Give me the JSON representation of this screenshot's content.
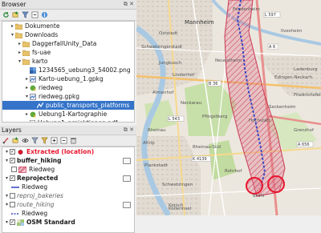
{
  "browser": {
    "title": "Browser",
    "controls": "⧉ ✕",
    "items": [
      {
        "label": "Dokumente",
        "depth": 1,
        "icon": "folder-icon",
        "expanded": false
      },
      {
        "label": "Downloads",
        "depth": 1,
        "icon": "folder-icon",
        "expanded": true
      },
      {
        "label": "DaggerfallUnity_Data",
        "depth": 2,
        "icon": "folder-icon",
        "expanded": false
      },
      {
        "label": "fs-uae",
        "depth": 2,
        "icon": "folder-icon",
        "expanded": false
      },
      {
        "label": "karto",
        "depth": 2,
        "icon": "folder-icon",
        "expanded": true
      },
      {
        "label": "1234565_uebung3_54002.png",
        "depth": 3,
        "icon": "raster-icon",
        "expanded": null
      },
      {
        "label": "Karto-uebung_1.gpkg",
        "depth": 3,
        "icon": "geopackage-icon",
        "expanded": false
      },
      {
        "label": "riedweg",
        "depth": 3,
        "icon": "qgis-project-icon",
        "expanded": false
      },
      {
        "label": "riedweg.gpkg",
        "depth": 3,
        "icon": "geopackage-icon",
        "expanded": true
      },
      {
        "label": "public_transports_platforms",
        "depth": 4,
        "icon": "line-layer-icon",
        "expanded": null,
        "selected": true
      },
      {
        "label": "Uebung1-Kartographie",
        "depth": 3,
        "icon": "qgis-project-icon",
        "expanded": false
      },
      {
        "label": "Uebung1_projektionen.pdf",
        "depth": 3,
        "icon": "pdf-icon",
        "expanded": null
      }
    ]
  },
  "layers": {
    "title": "Layers",
    "controls": "⧉ ✕",
    "items": [
      {
        "label": "Extracted (location)",
        "depth": 0,
        "checked": true,
        "style": "bold-selected",
        "sym": "point",
        "indicator": false
      },
      {
        "label": "buffer_hiking",
        "depth": 0,
        "checked": true,
        "style": "bold",
        "sym": "group",
        "indicator": true
      },
      {
        "label": "Riedweg",
        "depth": 1,
        "checked": false,
        "style": "normal",
        "sym": "hatch",
        "indicator": false
      },
      {
        "label": "Reprojected",
        "depth": 0,
        "checked": true,
        "style": "bold",
        "sym": "group",
        "indicator": true
      },
      {
        "label": "Riedweg",
        "depth": 1,
        "checked": null,
        "style": "normal",
        "sym": "blue-line",
        "indicator": false
      },
      {
        "label": "reproj_bakeries",
        "depth": 0,
        "checked": false,
        "style": "italic-grey",
        "sym": "none",
        "indicator": false
      },
      {
        "label": "route_hiking",
        "depth": 0,
        "checked": false,
        "style": "italic-grey",
        "sym": "group",
        "indicator": true
      },
      {
        "label": "Riedweg",
        "depth": 1,
        "checked": null,
        "style": "normal",
        "sym": "blue-dash",
        "indicator": false
      },
      {
        "label": "OSM Standard",
        "depth": 0,
        "checked": true,
        "style": "bold",
        "sym": "raster",
        "indicator": false
      }
    ]
  },
  "map": {
    "place_labels": [
      {
        "text": "Feudenheim"
      },
      {
        "text": "Oststadt"
      },
      {
        "text": "Schwetzingerstadt"
      },
      {
        "text": "Neuostheim"
      },
      {
        "text": "Ladenburg"
      },
      {
        "text": "Edingen-Neckarh."
      },
      {
        "text": "Friedrichsfeld"
      },
      {
        "text": "Almenhof"
      },
      {
        "text": "Pfingstberg"
      },
      {
        "text": "Rheinau"
      },
      {
        "text": "Hochstätt"
      },
      {
        "text": "Grenzhof"
      },
      {
        "text": "Brühl"
      },
      {
        "text": "Ketsch"
      },
      {
        "text": "Rohrhof"
      },
      {
        "text": "Mannheim"
      },
      {
        "text": "Plankstadt"
      },
      {
        "text": "Ilvesheim"
      },
      {
        "text": "Seckenheim"
      },
      {
        "text": "Schwetzingen"
      },
      {
        "text": "Kollerinsel"
      },
      {
        "text": "Rheinau-Süd"
      },
      {
        "text": "Altrip"
      },
      {
        "text": "Neckarau"
      },
      {
        "text": "Lindenhof"
      },
      {
        "text": "Jungbusch"
      }
    ],
    "road_labels": [
      "A 656",
      "L 597",
      "B 36",
      "A 6",
      "K 4139",
      "L 543"
    ],
    "colors": {
      "hatch": "#d0415b",
      "route": "#3a4bc4",
      "circle": "#e8152c",
      "water": "#a9c9e3",
      "green": "#c7dfa8"
    }
  }
}
